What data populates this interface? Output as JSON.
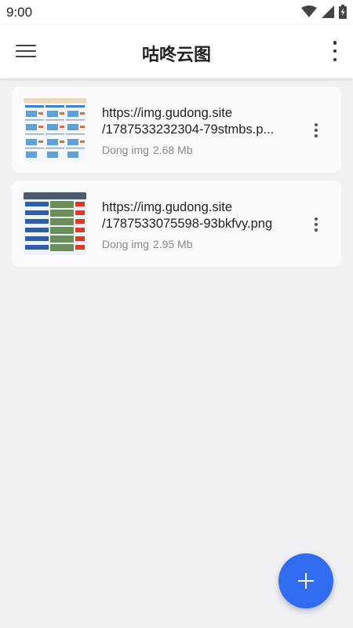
{
  "status_bar": {
    "time": "9:00",
    "icons": [
      "wifi-icon",
      "signal-icon",
      "battery-icon"
    ]
  },
  "app_bar": {
    "title": "咕咚云图",
    "menu_icon": "menu-icon",
    "more_icon": "more-vert-icon"
  },
  "images": [
    {
      "url_line1": "https://img.gudong.site",
      "url_line2": "/1787533232304-79stmbs.p...",
      "source": "Dong img",
      "size": "2.68 Mb"
    },
    {
      "url_line1": "https://img.gudong.site",
      "url_line2": "/1787533075598-93bkfvy.png",
      "source": "Dong img",
      "size": "2.95 Mb"
    }
  ],
  "fab": {
    "icon": "add-icon"
  },
  "colors": {
    "accent": "#2f6cf0",
    "background": "#f0f0f5",
    "card": "#fbfbfd",
    "meta_text": "#8a8a8a"
  }
}
